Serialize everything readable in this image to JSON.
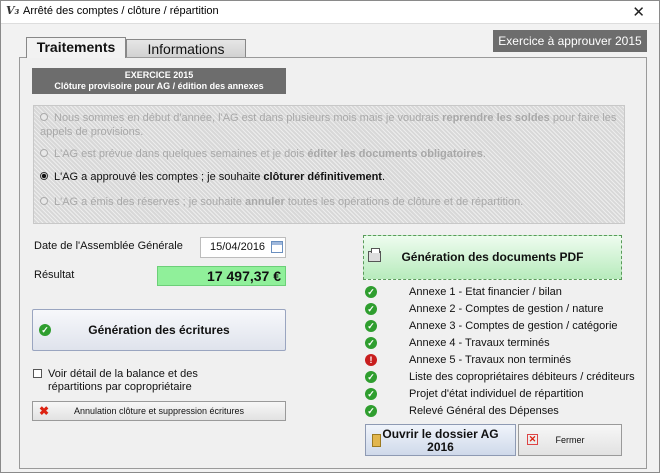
{
  "window": {
    "title": "Arrêté des comptes / clôture / répartition",
    "app_icon": "V₃",
    "close_glyph": "✕"
  },
  "tabs": [
    {
      "label": "Traitements",
      "active": true
    },
    {
      "label": "Informations",
      "active": false
    }
  ],
  "exercice_badge": "Exercice à approuver 2015",
  "header": {
    "line1": "EXERCICE 2015",
    "line2": "Clôture provisoire pour AG / édition des annexes"
  },
  "options": [
    {
      "pre": "Nous sommes en début d'année, l'AG est dans plusieurs mois mais je voudrais ",
      "bold": "reprendre les soldes",
      "post": " pour faire les appels de provisions.",
      "enabled": false,
      "selected": false
    },
    {
      "pre": "L'AG est prévue dans quelques semaines et je dois ",
      "bold": "éditer les documents obligatoires",
      "post": ".",
      "enabled": false,
      "selected": false
    },
    {
      "pre": "L'AG a approuvé les comptes ; je souhaite ",
      "bold": "clôturer définitivement",
      "post": ".",
      "enabled": true,
      "selected": true
    },
    {
      "pre": "L'AG a émis des réserves ; je souhaite ",
      "bold": "annuler",
      "post": " toutes les opérations de clôture et de répartition.",
      "enabled": false,
      "selected": false
    }
  ],
  "ag_date": {
    "label": "Date de l'Assemblée Générale",
    "value": "15/04/2016"
  },
  "result": {
    "label": "Résultat",
    "value": "17 497,37 €"
  },
  "buttons": {
    "generate_entries": "Génération des écritures",
    "cancel_closing": "Annulation clôture et suppression écritures",
    "generate_pdf": "Génération des documents PDF",
    "open_folder_line1": "Ouvrir le dossier AG",
    "open_folder_line2": "2016",
    "close": "Fermer"
  },
  "detail_checkbox": {
    "label": "Voir détail de la balance et des répartitions par copropriétaire",
    "checked": false
  },
  "annexes": [
    {
      "label": "Annexe 1 - Etat financier / bilan",
      "status": "ok"
    },
    {
      "label": "Annexe 2 - Comptes de gestion / nature",
      "status": "ok"
    },
    {
      "label": "Annexe 3 - Comptes de gestion / catégorie",
      "status": "ok"
    },
    {
      "label": "Annexe 4 - Travaux terminés",
      "status": "ok"
    },
    {
      "label": "Annexe 5 - Travaux non terminés",
      "status": "error"
    },
    {
      "label": "Liste des copropriétaires débiteurs / créditeurs",
      "status": "ok"
    },
    {
      "label": "Projet d'état individuel de répartition",
      "status": "ok"
    },
    {
      "label": "Relevé Général des Dépenses",
      "status": "ok"
    }
  ],
  "colors": {
    "result_bg": "#90f09a",
    "ok": "#2f9e2f",
    "error": "#c81e1e",
    "badge_bg": "#6d6d6d"
  }
}
